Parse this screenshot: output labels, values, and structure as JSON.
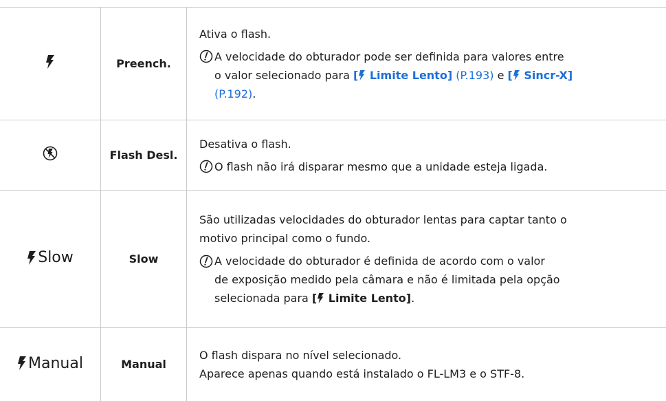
{
  "rows": [
    {
      "icon": "flash-fill-icon",
      "icon_text": "",
      "name": "Preench.",
      "desc_line1": "Ativa o flash.",
      "note": {
        "line1": "A velocidade do obturador pode ser definida para valores entre",
        "line2_pre": "o valor selecionado para ",
        "link1_open": "[",
        "link1_text": " Limite Lento]",
        "link1_ref": " (P.193)",
        "mid": " e ",
        "link2_open": "[",
        "link2_text": " Sincr-X]",
        "link2_ref": "(P.192)",
        "end": "."
      }
    },
    {
      "icon": "flash-off-icon",
      "icon_text": "",
      "name": "Flash Desl.",
      "desc_line1": "Desativa o flash.",
      "note": {
        "line1": "O flash não irá disparar mesmo que a unidade esteja ligada."
      }
    },
    {
      "icon": "flash-slow-icon",
      "icon_text": "Slow",
      "name": "Slow",
      "desc_line1": "São utilizadas velocidades do obturador lentas para captar tanto o",
      "desc_line2": "motivo principal como o fundo.",
      "note": {
        "line1": "A velocidade do obturador é definida de acordo com o valor",
        "line2": "de exposição medido pela câmara e não é limitada pela opção",
        "line3_pre": "selecionada para ",
        "link_open": "[",
        "link_text": " Limite Lento]",
        "end": "."
      }
    },
    {
      "icon": "flash-manual-icon",
      "icon_text": "Manual",
      "name": "Manual",
      "desc_line1": "O flash dispara no nível selecionado.",
      "desc_line2": "Aparece apenas quando está instalado o FL-LM3 e o STF-8."
    }
  ],
  "colors": {
    "link": "#1b6fd8",
    "border": "#c9c9c9",
    "text": "#1e1e1e"
  }
}
